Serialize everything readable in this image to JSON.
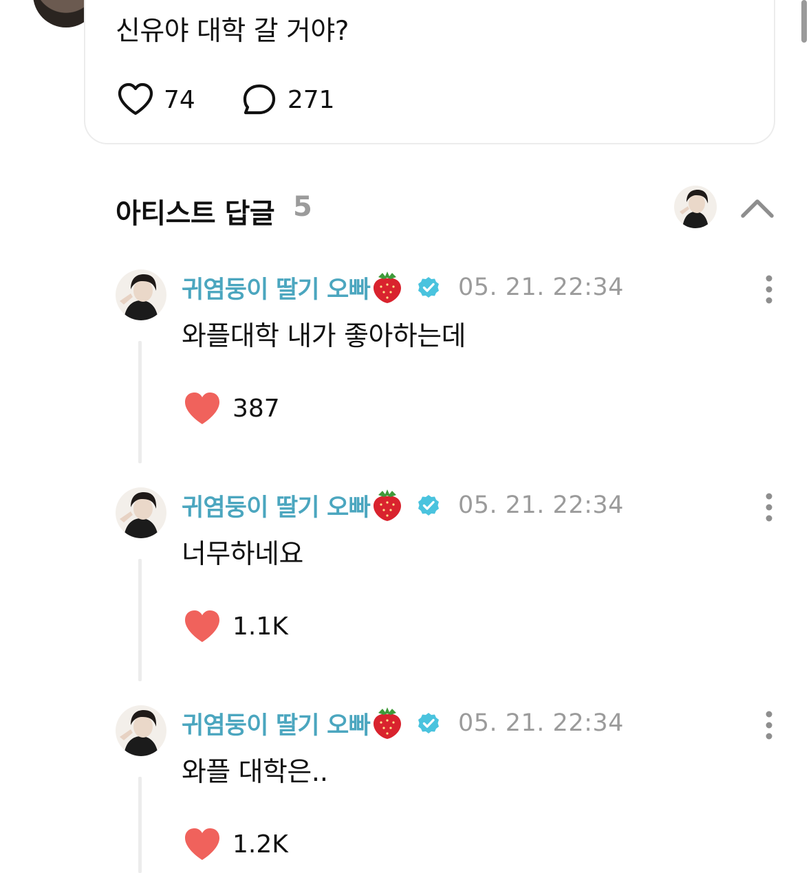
{
  "post": {
    "text": "신유야 대학 갈 거야?",
    "like_count": "74",
    "comment_count": "271"
  },
  "artist_replies": {
    "title": "아티스트 답글",
    "count": "5"
  },
  "replies": [
    {
      "author": "귀염둥이 딸기 오빠",
      "timestamp": "05. 21. 22:34",
      "text": "와플대학 내가 좋아하는데",
      "likes": "387"
    },
    {
      "author": "귀염둥이 딸기 오빠",
      "timestamp": "05. 21. 22:34",
      "text": "너무하네요",
      "likes": "1.1K"
    },
    {
      "author": "귀염둥이 딸기 오빠",
      "timestamp": "05. 21. 22:34",
      "text": "와플 대학은..",
      "likes": "1.2K"
    }
  ],
  "icons": {
    "like": "heart-outline-icon",
    "comment": "speech-bubble-icon",
    "liked": "heart-filled-icon",
    "verified": "verified-badge-icon",
    "emoji": "strawberry-icon",
    "more": "more-vertical-icon",
    "collapse": "chevron-up-icon"
  },
  "colors": {
    "author_name": "#4ba6bf",
    "verified_badge": "#4ac3de",
    "heart_filled": "#f0625c",
    "muted_text": "#9b9b9b"
  }
}
